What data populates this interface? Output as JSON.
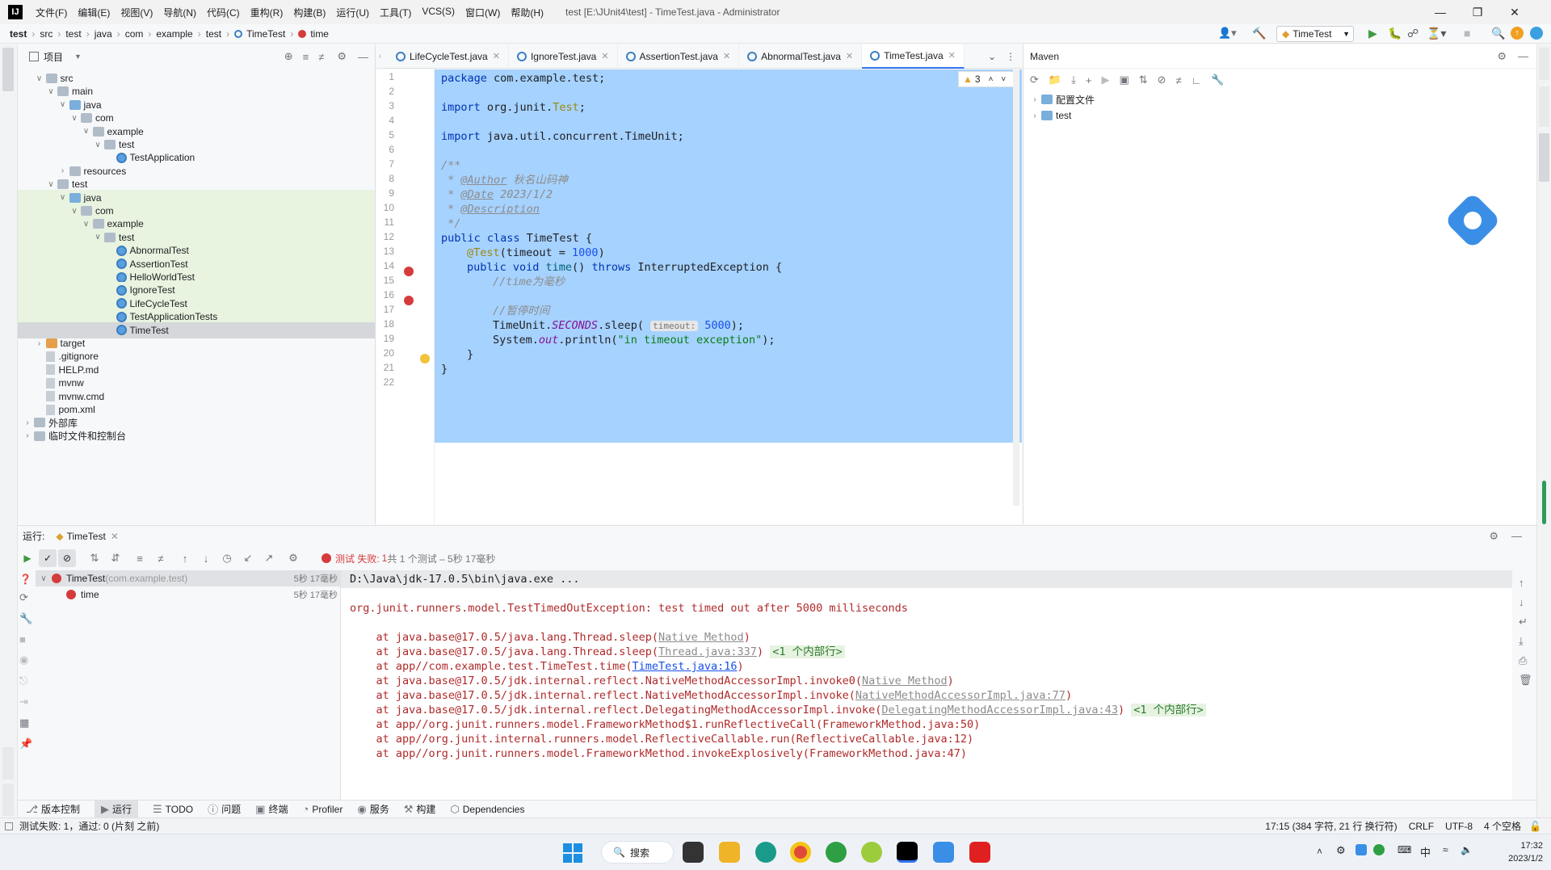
{
  "titlebar": {
    "menus": [
      "文件(F)",
      "编辑(E)",
      "视图(V)",
      "导航(N)",
      "代码(C)",
      "重构(R)",
      "构建(B)",
      "运行(U)",
      "工具(T)",
      "VCS(S)",
      "窗口(W)",
      "帮助(H)"
    ],
    "window_title": "test [E:\\JUnit4\\test] - TimeTest.java - Administrator"
  },
  "navbar": {
    "breadcrumbs": [
      "test",
      "src",
      "test",
      "java",
      "com",
      "example",
      "test",
      "TimeTest",
      "time"
    ],
    "run_config": "TimeTest"
  },
  "project": {
    "title": "项目",
    "tree": [
      {
        "label": "src",
        "indent": 1,
        "arrow": "v",
        "icon": "folder"
      },
      {
        "label": "main",
        "indent": 2,
        "arrow": "v",
        "icon": "folder"
      },
      {
        "label": "java",
        "indent": 3,
        "arrow": "v",
        "icon": "folder-blue"
      },
      {
        "label": "com",
        "indent": 4,
        "arrow": "v",
        "icon": "folder"
      },
      {
        "label": "example",
        "indent": 5,
        "arrow": "v",
        "icon": "folder"
      },
      {
        "label": "test",
        "indent": 6,
        "arrow": "v",
        "icon": "folder"
      },
      {
        "label": "TestApplication",
        "indent": 7,
        "arrow": "",
        "icon": "class"
      },
      {
        "label": "resources",
        "indent": 3,
        "arrow": ">",
        "icon": "folder"
      },
      {
        "label": "test",
        "indent": 2,
        "arrow": "v",
        "icon": "folder"
      },
      {
        "label": "java",
        "indent": 3,
        "arrow": "v",
        "icon": "folder-blue",
        "hl": true
      },
      {
        "label": "com",
        "indent": 4,
        "arrow": "v",
        "icon": "folder",
        "hl": true
      },
      {
        "label": "example",
        "indent": 5,
        "arrow": "v",
        "icon": "folder",
        "hl": true
      },
      {
        "label": "test",
        "indent": 6,
        "arrow": "v",
        "icon": "folder",
        "hl": true
      },
      {
        "label": "AbnormalTest",
        "indent": 7,
        "arrow": "",
        "icon": "class",
        "hl": true
      },
      {
        "label": "AssertionTest",
        "indent": 7,
        "arrow": "",
        "icon": "class",
        "hl": true
      },
      {
        "label": "HelloWorldTest",
        "indent": 7,
        "arrow": "",
        "icon": "class",
        "hl": true
      },
      {
        "label": "IgnoreTest",
        "indent": 7,
        "arrow": "",
        "icon": "class",
        "hl": true
      },
      {
        "label": "LifeCycleTest",
        "indent": 7,
        "arrow": "",
        "icon": "class",
        "hl": true
      },
      {
        "label": "TestApplicationTests",
        "indent": 7,
        "arrow": "",
        "icon": "class",
        "hl": true
      },
      {
        "label": "TimeTest",
        "indent": 7,
        "arrow": "",
        "icon": "class",
        "sel": true
      },
      {
        "label": "target",
        "indent": 1,
        "arrow": ">",
        "icon": "folder-orange"
      },
      {
        "label": ".gitignore",
        "indent": 1,
        "arrow": "",
        "icon": "file"
      },
      {
        "label": "HELP.md",
        "indent": 1,
        "arrow": "",
        "icon": "file"
      },
      {
        "label": "mvnw",
        "indent": 1,
        "arrow": "",
        "icon": "file"
      },
      {
        "label": "mvnw.cmd",
        "indent": 1,
        "arrow": "",
        "icon": "file"
      },
      {
        "label": "pom.xml",
        "indent": 1,
        "arrow": "",
        "icon": "file"
      },
      {
        "label": "外部库",
        "indent": 0,
        "arrow": ">",
        "icon": "lib"
      },
      {
        "label": "临时文件和控制台",
        "indent": 0,
        "arrow": ">",
        "icon": "lib"
      }
    ]
  },
  "editor": {
    "tabs": [
      "LifeCycleTest.java",
      "IgnoreTest.java",
      "AssertionTest.java",
      "AbnormalTest.java",
      "TimeTest.java"
    ],
    "active_tab": "TimeTest.java",
    "warning_count": "3",
    "line_numbers": [
      "1",
      "2",
      "3",
      "4",
      "5",
      "6",
      "7",
      "8",
      "9",
      "10",
      "11",
      "12",
      "13",
      "14",
      "15",
      "16",
      "17",
      "18",
      "19",
      "20",
      "21",
      "22"
    ],
    "code": {
      "l1_kw": "package",
      "l1_rest": " com.example.test;",
      "l3_kw": "import",
      "l3_rest": " org.junit.",
      "l3_ann": "Test",
      "l3_end": ";",
      "l5_kw": "import",
      "l5_rest": " java.util.concurrent.TimeUnit;",
      "l7": "/**",
      "l8_a": " * ",
      "l8_tag": "@Author",
      "l8_val": " 秋名山码神",
      "l9_a": " * ",
      "l9_tag": "@Date",
      "l9_val": " 2023/1/2",
      "l10_a": " * ",
      "l10_tag": "@Description",
      "l11": " */",
      "l12_kw": "public class",
      "l12_rest": " TimeTest {",
      "l13_ann": "@Test",
      "l13_a": "(timeout = ",
      "l13_num": "1000",
      "l13_b": ")",
      "l14_kw": "public void",
      "l14_fn": " time",
      "l14_a": "() ",
      "l14_kw2": "throws",
      "l14_b": " InterruptedException {",
      "l15": "//time为毫秒",
      "l17": "//暂停时间",
      "l18_a": "TimeUnit.",
      "l18_fld": "SECONDS",
      "l18_b": ".sleep( ",
      "l18_hint": "timeout:",
      "l18_num": " 5000",
      "l18_c": ");",
      "l19_a": "System.",
      "l19_fld": "out",
      "l19_b": ".println(",
      "l19_str": "\"in timeout exception\"",
      "l19_c": ");",
      "l20": "}",
      "l21": "}"
    }
  },
  "maven": {
    "title": "Maven",
    "tree": [
      "配置文件",
      "test"
    ]
  },
  "run": {
    "label": "运行:",
    "tab": "TimeTest",
    "status_prefix": "测试 失败:",
    "status_count": "1",
    "status_rest": "共 1 个测试 – 5秒 17毫秒",
    "test_tree": [
      {
        "label": "TimeTest",
        "sub": " (com.example.test)",
        "time": "5秒 17毫秒"
      },
      {
        "label": "time",
        "sub": "",
        "time": "5秒 17毫秒"
      }
    ],
    "console": {
      "l0": "D:\\Java\\jdk-17.0.5\\bin\\java.exe ...",
      "l2": "org.junit.runners.model.TestTimedOutException: test timed out after 5000 milliseconds",
      "l4_a": "    at java.base@17.0.5/java.lang.Thread.sleep(",
      "l4_link": "Native Method",
      "l4_b": ")",
      "l5_a": "    at java.base@17.0.5/java.lang.Thread.sleep(",
      "l5_link": "Thread.java:337",
      "l5_b": ") ",
      "l5_fold": "<1 个内部行>",
      "l6_a": "    at app//com.example.test.TimeTest.time(",
      "l6_link": "TimeTest.java:16",
      "l6_b": ")",
      "l7_a": "    at java.base@17.0.5/jdk.internal.reflect.NativeMethodAccessorImpl.invoke0(",
      "l7_link": "Native Method",
      "l7_b": ")",
      "l8_a": "    at java.base@17.0.5/jdk.internal.reflect.NativeMethodAccessorImpl.invoke(",
      "l8_link": "NativeMethodAccessorImpl.java:77",
      "l8_b": ")",
      "l9_a": "    at java.base@17.0.5/jdk.internal.reflect.DelegatingMethodAccessorImpl.invoke(",
      "l9_link": "DelegatingMethodAccessorImpl.java:43",
      "l9_b": ") ",
      "l9_fold": "<1 个内部行>",
      "l10": "    at app//org.junit.runners.model.FrameworkMethod$1.runReflectiveCall(FrameworkMethod.java:50)",
      "l11": "    at app//org.junit.internal.runners.model.ReflectiveCallable.run(ReflectiveCallable.java:12)",
      "l12": "    at app//org.junit.runners.model.FrameworkMethod.invokeExplosively(FrameworkMethod.java:47)"
    }
  },
  "bottom_tabs": [
    "版本控制",
    "运行",
    "TODO",
    "问题",
    "终端",
    "Profiler",
    "服务",
    "构建",
    "Dependencies"
  ],
  "statusbar": {
    "left": "测试失败: 1，通过: 0 (片刻 之前)",
    "position": "17:15 (384 字符, 21 行 换行符)",
    "line_sep": "CRLF",
    "encoding": "UTF-8",
    "indent": "4 个空格"
  },
  "taskbar": {
    "search": "搜索",
    "time": "17:32",
    "date": "2023/1/2",
    "ime": "中"
  }
}
